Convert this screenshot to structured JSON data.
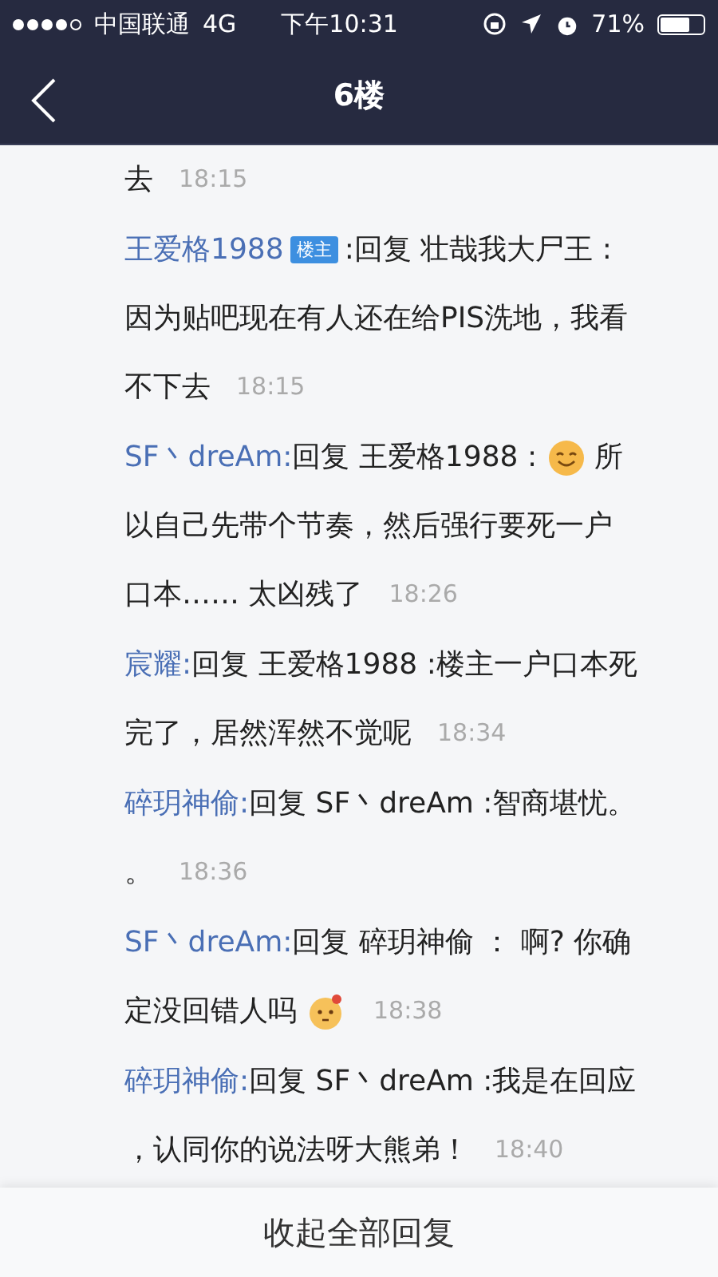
{
  "status_bar": {
    "signal_dots": [
      true,
      true,
      true,
      true,
      false
    ],
    "carrier": "中国联通",
    "network": "4G",
    "time": "下午10:31",
    "battery_text": "71%",
    "battery": {
      "level": 0.71
    }
  },
  "nav": {
    "title": "6楼"
  },
  "replies": [
    {
      "lines": [
        [
          {
            "kind": "text",
            "text": "去"
          },
          {
            "kind": "time",
            "text": "18:15"
          }
        ]
      ]
    },
    {
      "lines": [
        [
          {
            "kind": "author",
            "text": "王爱格1988"
          },
          {
            "kind": "badge",
            "text": "楼主"
          },
          {
            "kind": "text",
            "text": ":回复 壮哉我大尸王 :"
          }
        ],
        [
          {
            "kind": "text",
            "text": "因为贴吧现在有人还在给PIS洗地，我看"
          }
        ],
        [
          {
            "kind": "text",
            "text": "不下去"
          },
          {
            "kind": "time",
            "text": "18:15"
          }
        ]
      ]
    },
    {
      "lines": [
        [
          {
            "kind": "author",
            "text": "SF丶dreAm:"
          },
          {
            "kind": "text",
            "text": "回复 王爱格1988 :"
          },
          {
            "kind": "smile-emoji"
          },
          {
            "kind": "text",
            "text": "所"
          }
        ],
        [
          {
            "kind": "text",
            "text": "以自己先带个节奏，然后强行要死一户"
          }
        ],
        [
          {
            "kind": "text",
            "text": "口本…… 太凶残了"
          },
          {
            "kind": "time",
            "text": "18:26"
          }
        ]
      ]
    },
    {
      "lines": [
        [
          {
            "kind": "author",
            "text": "宸耀:"
          },
          {
            "kind": "text",
            "text": "回复 王爱格1988 :楼主一户口本死"
          }
        ],
        [
          {
            "kind": "text",
            "text": "完了，居然浑然不觉呢"
          },
          {
            "kind": "time",
            "text": "18:34"
          }
        ]
      ]
    },
    {
      "lines": [
        [
          {
            "kind": "author",
            "text": "碎玥神偷:"
          },
          {
            "kind": "text",
            "text": "回复 SF丶dreAm :智商堪忧。"
          }
        ],
        [
          {
            "kind": "text",
            "text": "。"
          },
          {
            "kind": "time",
            "text": "18:36"
          }
        ]
      ]
    },
    {
      "lines": [
        [
          {
            "kind": "author",
            "text": "SF丶dreAm:"
          },
          {
            "kind": "text",
            "text": "回复 碎玥神偷 ： 啊? 你确"
          }
        ],
        [
          {
            "kind": "text",
            "text": "定没回错人吗"
          },
          {
            "kind": "confused-emoji"
          },
          {
            "kind": "time",
            "text": "18:38"
          }
        ]
      ]
    },
    {
      "lines": [
        [
          {
            "kind": "author",
            "text": "碎玥神偷:"
          },
          {
            "kind": "text",
            "text": "回复 SF丶dreAm :我是在回应"
          }
        ],
        [
          {
            "kind": "text",
            "text": "，认同你的说法呀大熊弟！"
          },
          {
            "kind": "time",
            "text": "18:40"
          }
        ]
      ]
    }
  ],
  "footer": {
    "button": "收起全部回复"
  }
}
